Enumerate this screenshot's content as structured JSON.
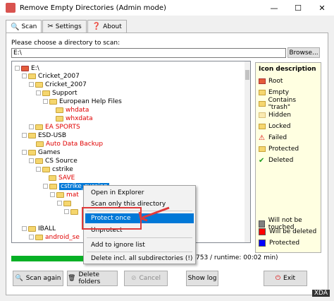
{
  "window": {
    "title": "Remove Empty Directories (Admin mode)",
    "controls": [
      "—",
      "☐",
      "✕"
    ]
  },
  "tabs": [
    {
      "label": "Scan",
      "icon": "magnifier-icon"
    },
    {
      "label": "Settings",
      "icon": "tools-icon"
    },
    {
      "label": "About",
      "icon": "help-icon"
    }
  ],
  "scan": {
    "dir_label": "Please choose a directory to scan:",
    "dir_value": "E:\\",
    "browse_label": "Browse..."
  },
  "tree": {
    "nodes": [
      {
        "text": "E:\\",
        "color": "black"
      },
      {
        "text": "Cricket_2007",
        "color": "black"
      },
      {
        "text": "Cricket_2007",
        "color": "black"
      },
      {
        "text": "Support",
        "color": "black"
      },
      {
        "text": "European Help Files",
        "color": "black"
      },
      {
        "text": "whdata",
        "color": "red"
      },
      {
        "text": "whxdata",
        "color": "red"
      },
      {
        "text": "EA SPORTS",
        "color": "red"
      },
      {
        "text": "ESD-USB",
        "color": "black"
      },
      {
        "text": "Auto Data Backup",
        "color": "red"
      },
      {
        "text": "Games",
        "color": "black"
      },
      {
        "text": "CS Source",
        "color": "black"
      },
      {
        "text": "cstrike",
        "color": "black"
      },
      {
        "text": "SAVE",
        "color": "red"
      },
      {
        "text": "cstrike_russian",
        "color": "selected"
      },
      {
        "text": "mat",
        "color": "red"
      },
      {
        "text": "IBALL",
        "color": "black"
      },
      {
        "text": "android_se",
        "color": "red"
      }
    ]
  },
  "legend": {
    "title": "Icon description",
    "items": [
      {
        "label": "Root",
        "icon": "root-icon"
      },
      {
        "label": "Empty",
        "icon": "folder-icon"
      },
      {
        "label": "Contains \"trash\"",
        "icon": "trash-folder-icon"
      },
      {
        "label": "Hidden",
        "icon": "hidden-folder-icon"
      },
      {
        "label": "Locked",
        "icon": "locked-folder-icon"
      },
      {
        "label": "Failed",
        "icon": "warning-icon"
      },
      {
        "label": "Protected",
        "icon": "protected-folder-icon"
      },
      {
        "label": "Deleted",
        "icon": "check-icon"
      }
    ],
    "colors": [
      {
        "label": "Will not be touched",
        "color": "#808080"
      },
      {
        "label": "Will be deleted",
        "color": "#ff0000"
      },
      {
        "label": "Protected",
        "color": "#0000ff"
      }
    ]
  },
  "status": {
    "runtime_text": "753 / runtime: 00:02 min)",
    "progress": 1.0
  },
  "buttons": {
    "scan_again": "Scan again",
    "delete_folders": "Delete folders",
    "cancel": "Cancel",
    "show_log": "Show log",
    "exit": "Exit"
  },
  "context_menu": {
    "open_explorer": "Open in Explorer",
    "scan_only": "Scan only this directory",
    "protect_once": "Protect once",
    "unprotect": "Unprotect",
    "add_ignore": "Add to ignore list",
    "delete_all": "Delete incl. all subdirectories (!)"
  },
  "watermark": "XDA"
}
